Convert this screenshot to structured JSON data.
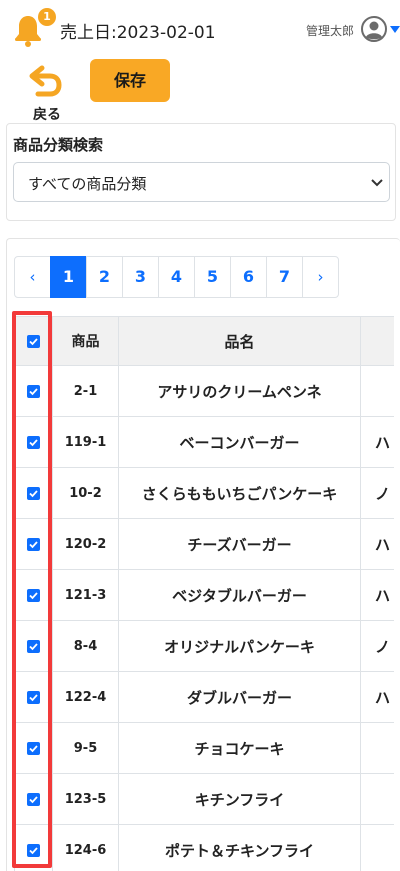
{
  "header": {
    "notification_count": "1",
    "sales_date": "売上日:2023-02-01",
    "user_name": "管理太郎"
  },
  "toolbar": {
    "back_label": "戻る",
    "save_label": "保存"
  },
  "filter": {
    "label": "商品分類検索",
    "selected": "すべての商品分類"
  },
  "pagination": {
    "prev": "‹",
    "next": "›",
    "pages": [
      "1",
      "2",
      "3",
      "4",
      "5",
      "6",
      "7"
    ],
    "active_page": "1"
  },
  "table": {
    "headers": {
      "code": "商品",
      "name": "品名",
      "extra": ""
    },
    "rows": [
      {
        "code": "2-1",
        "name": "アサリのクリームペンネ",
        "extra": "",
        "checked": true
      },
      {
        "code": "119-1",
        "name": "ベーコンバーガー",
        "extra": "ハ",
        "checked": true
      },
      {
        "code": "10-2",
        "name": "さくらももいちごパンケーキ",
        "extra": "ノ",
        "checked": true
      },
      {
        "code": "120-2",
        "name": "チーズバーガー",
        "extra": "ハ",
        "checked": true
      },
      {
        "code": "121-3",
        "name": "ベジタブルバーガー",
        "extra": "ハ",
        "checked": true
      },
      {
        "code": "8-4",
        "name": "オリジナルパンケーキ",
        "extra": "ノ",
        "checked": true
      },
      {
        "code": "122-4",
        "name": "ダブルバーガー",
        "extra": "ハ",
        "checked": true
      },
      {
        "code": "9-5",
        "name": "チョコケーキ",
        "extra": "",
        "checked": true
      },
      {
        "code": "123-5",
        "name": "キチンフライ",
        "extra": "",
        "checked": true
      },
      {
        "code": "124-6",
        "name": "ポテト＆チキンフライ",
        "extra": "",
        "checked": true
      }
    ]
  },
  "colors": {
    "accent": "#0d6efd",
    "warning": "#f9a825",
    "highlight": "#f23a3a"
  },
  "icons": [
    "bell-icon",
    "user-avatar-icon",
    "chevron-down-icon",
    "back-arrow-icon",
    "select-chevron-icon",
    "checkbox-checked-icon"
  ]
}
